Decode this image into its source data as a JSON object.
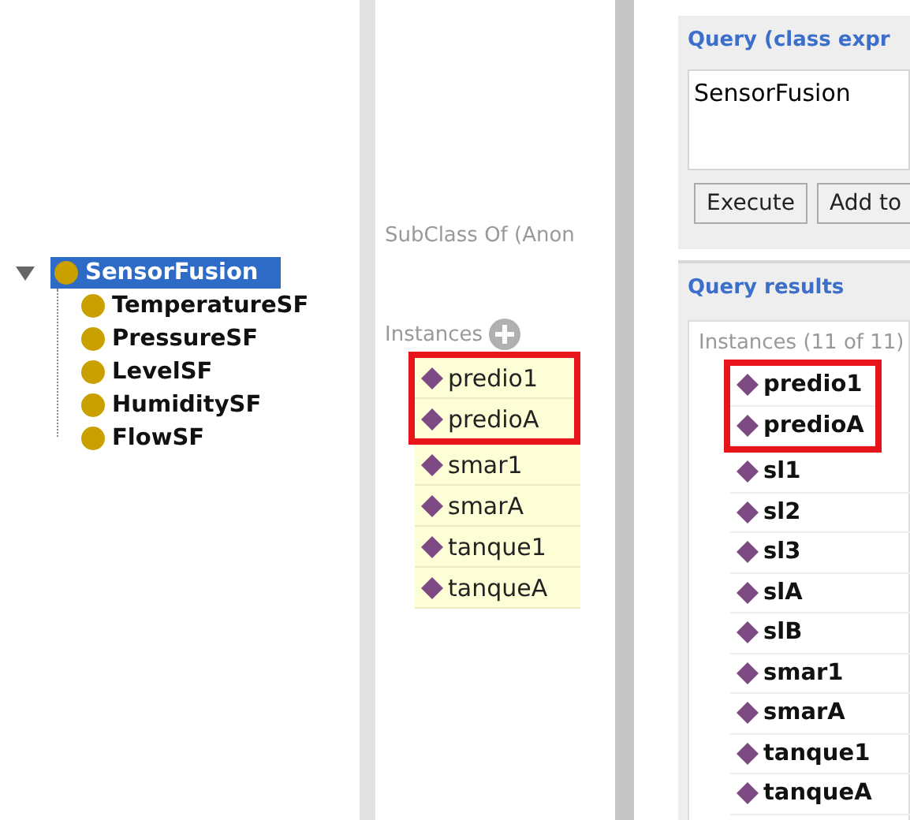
{
  "class_tree": {
    "root": {
      "label": "SensorFusion",
      "selected": true,
      "expanded": true,
      "children": [
        {
          "label": "TemperatureSF",
          "selected": false
        },
        {
          "label": "PressureSF",
          "selected": false
        },
        {
          "label": "LevelSF",
          "selected": false
        },
        {
          "label": "HumiditySF",
          "selected": false
        },
        {
          "label": "FlowSF",
          "selected": false
        }
      ]
    }
  },
  "description": {
    "subclass_heading": "SubClass Of (Anon",
    "instances_heading": "Instances",
    "instances": [
      {
        "label": "predio1",
        "highlighted": true
      },
      {
        "label": "predioA",
        "highlighted": true
      },
      {
        "label": "smar1",
        "highlighted": false
      },
      {
        "label": "smarA",
        "highlighted": false
      },
      {
        "label": "tanque1",
        "highlighted": false
      },
      {
        "label": "tanqueA",
        "highlighted": false
      }
    ]
  },
  "query": {
    "title": "Query (class expr",
    "value": "SensorFusion",
    "buttons": [
      "Execute",
      "Add to"
    ]
  },
  "results": {
    "title": "Query results",
    "heading": "Instances (11 of 11)",
    "items": [
      {
        "label": "predio1",
        "highlighted": true
      },
      {
        "label": "predioA",
        "highlighted": true
      },
      {
        "label": "sl1",
        "highlighted": false
      },
      {
        "label": "sl2",
        "highlighted": false
      },
      {
        "label": "sl3",
        "highlighted": false
      },
      {
        "label": "slA",
        "highlighted": false
      },
      {
        "label": "slB",
        "highlighted": false
      },
      {
        "label": "smar1",
        "highlighted": false
      },
      {
        "label": "smarA",
        "highlighted": false
      },
      {
        "label": "tanque1",
        "highlighted": false
      },
      {
        "label": "tanqueA",
        "highlighted": false
      }
    ]
  }
}
